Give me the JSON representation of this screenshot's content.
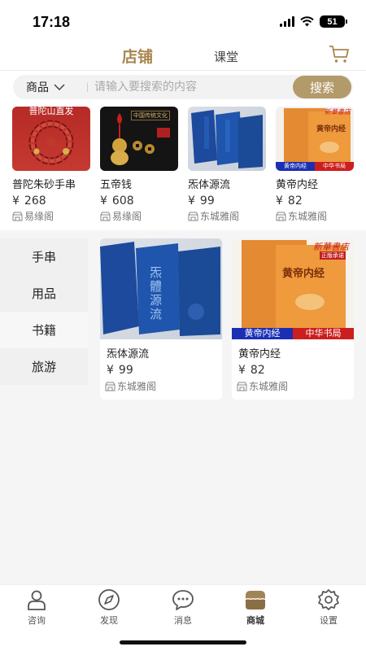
{
  "status": {
    "time": "17:18",
    "battery": "51"
  },
  "tabs": {
    "shop": "店铺",
    "class": "课堂"
  },
  "search": {
    "category": "商品",
    "placeholder": "请输入要搜索的内容",
    "button": "搜索"
  },
  "featured": [
    {
      "name": "普陀朱砂手串",
      "currency": "¥",
      "price": "268",
      "store": "易缘阁",
      "thumb_text": "普陀山直发"
    },
    {
      "name": "五帝钱",
      "currency": "¥",
      "price": "608",
      "store": "易缘阁",
      "thumb_text": "中国传统文化"
    },
    {
      "name": "炁体源流",
      "currency": "¥",
      "price": "99",
      "store": "东城雅阁"
    },
    {
      "name": "黄帝内经",
      "currency": "¥",
      "price": "82",
      "store": "东城雅阁",
      "thumb_text": "黄帝内经",
      "banner_left": "黄帝内经",
      "banner_right": "中华书局",
      "brand": "新華書店"
    }
  ],
  "categories": [
    "手串",
    "用品",
    "书籍",
    "旅游"
  ],
  "active_category": "书籍",
  "grid": [
    {
      "name": "炁体源流",
      "currency": "¥",
      "price": "99",
      "store": "东城雅阁",
      "cover_text": "炁體源流"
    },
    {
      "name": "黄帝内经",
      "currency": "¥",
      "price": "82",
      "store": "东城雅阁",
      "cover_text": "黄帝内经",
      "banner_left": "黄帝内经",
      "banner_right": "中华书局",
      "brand": "新華書店",
      "badge": "正版承诺"
    }
  ],
  "nav": [
    {
      "label": "咨询",
      "icon": "person-icon"
    },
    {
      "label": "发现",
      "icon": "compass-icon"
    },
    {
      "label": "消息",
      "icon": "chat-icon"
    },
    {
      "label": "商城",
      "icon": "shop-icon",
      "active": true
    },
    {
      "label": "设置",
      "icon": "gear-icon"
    }
  ],
  "colors": {
    "accent": "#a8864e",
    "button": "#b39a6a",
    "book_blue": "#1f4fa0",
    "book_orange": "#e48a32"
  }
}
